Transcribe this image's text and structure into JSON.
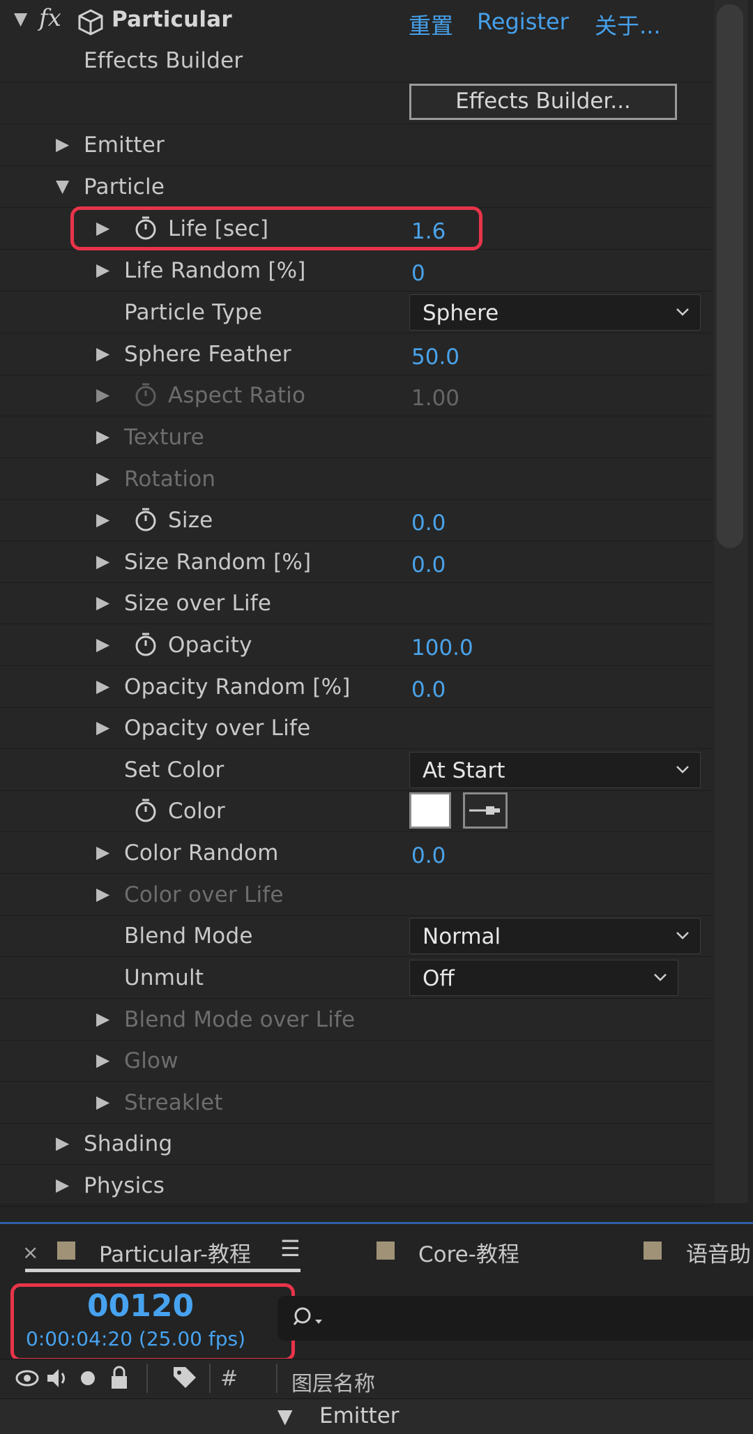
{
  "effect": {
    "name": "Particular",
    "fx_symbol": "fx",
    "links": {
      "reset": "重置",
      "register": "Register",
      "about": "关于..."
    }
  },
  "rows": {
    "effects_builder_label": "Effects Builder",
    "effects_builder_button": "Effects Builder...",
    "emitter": "Emitter",
    "particle": "Particle",
    "life": {
      "label": "Life [sec]",
      "value": "1.6"
    },
    "life_random": {
      "label": "Life Random [%]",
      "value": "0"
    },
    "particle_type": {
      "label": "Particle Type",
      "value": "Sphere"
    },
    "sphere_feather": {
      "label": "Sphere Feather",
      "value": "50.0"
    },
    "aspect_ratio": {
      "label": "Aspect Ratio",
      "value": "1.00"
    },
    "texture": "Texture",
    "rotation": "Rotation",
    "size": {
      "label": "Size",
      "value": "0.0"
    },
    "size_random": {
      "label": "Size Random [%]",
      "value": "0.0"
    },
    "size_over_life": "Size over Life",
    "opacity": {
      "label": "Opacity",
      "value": "100.0"
    },
    "opacity_random": {
      "label": "Opacity Random [%]",
      "value": "0.0"
    },
    "opacity_over_life": "Opacity over Life",
    "set_color": {
      "label": "Set Color",
      "value": "At Start"
    },
    "color": {
      "label": "Color",
      "swatch": "#ffffff"
    },
    "color_random": {
      "label": "Color Random",
      "value": "0.0"
    },
    "color_over_life": "Color over Life",
    "blend_mode": {
      "label": "Blend Mode",
      "value": "Normal"
    },
    "unmult": {
      "label": "Unmult",
      "value": "Off"
    },
    "blend_mode_over_life": "Blend Mode over Life",
    "glow": "Glow",
    "streaklet": "Streaklet",
    "shading": "Shading",
    "physics": "Physics"
  },
  "timeline": {
    "tabs": [
      "Particular-教程",
      "Core-教程",
      "语音助"
    ],
    "timecode": "00120",
    "timecode_sub": "0:00:04:20 (25.00 fps)",
    "col_hash": "#",
    "col_layer_name": "图层名称",
    "layer": "Emitter"
  },
  "colors": {
    "accent": "#4aa3ea",
    "highlight": "#e8344a",
    "tab_swatch": "#a09277"
  }
}
